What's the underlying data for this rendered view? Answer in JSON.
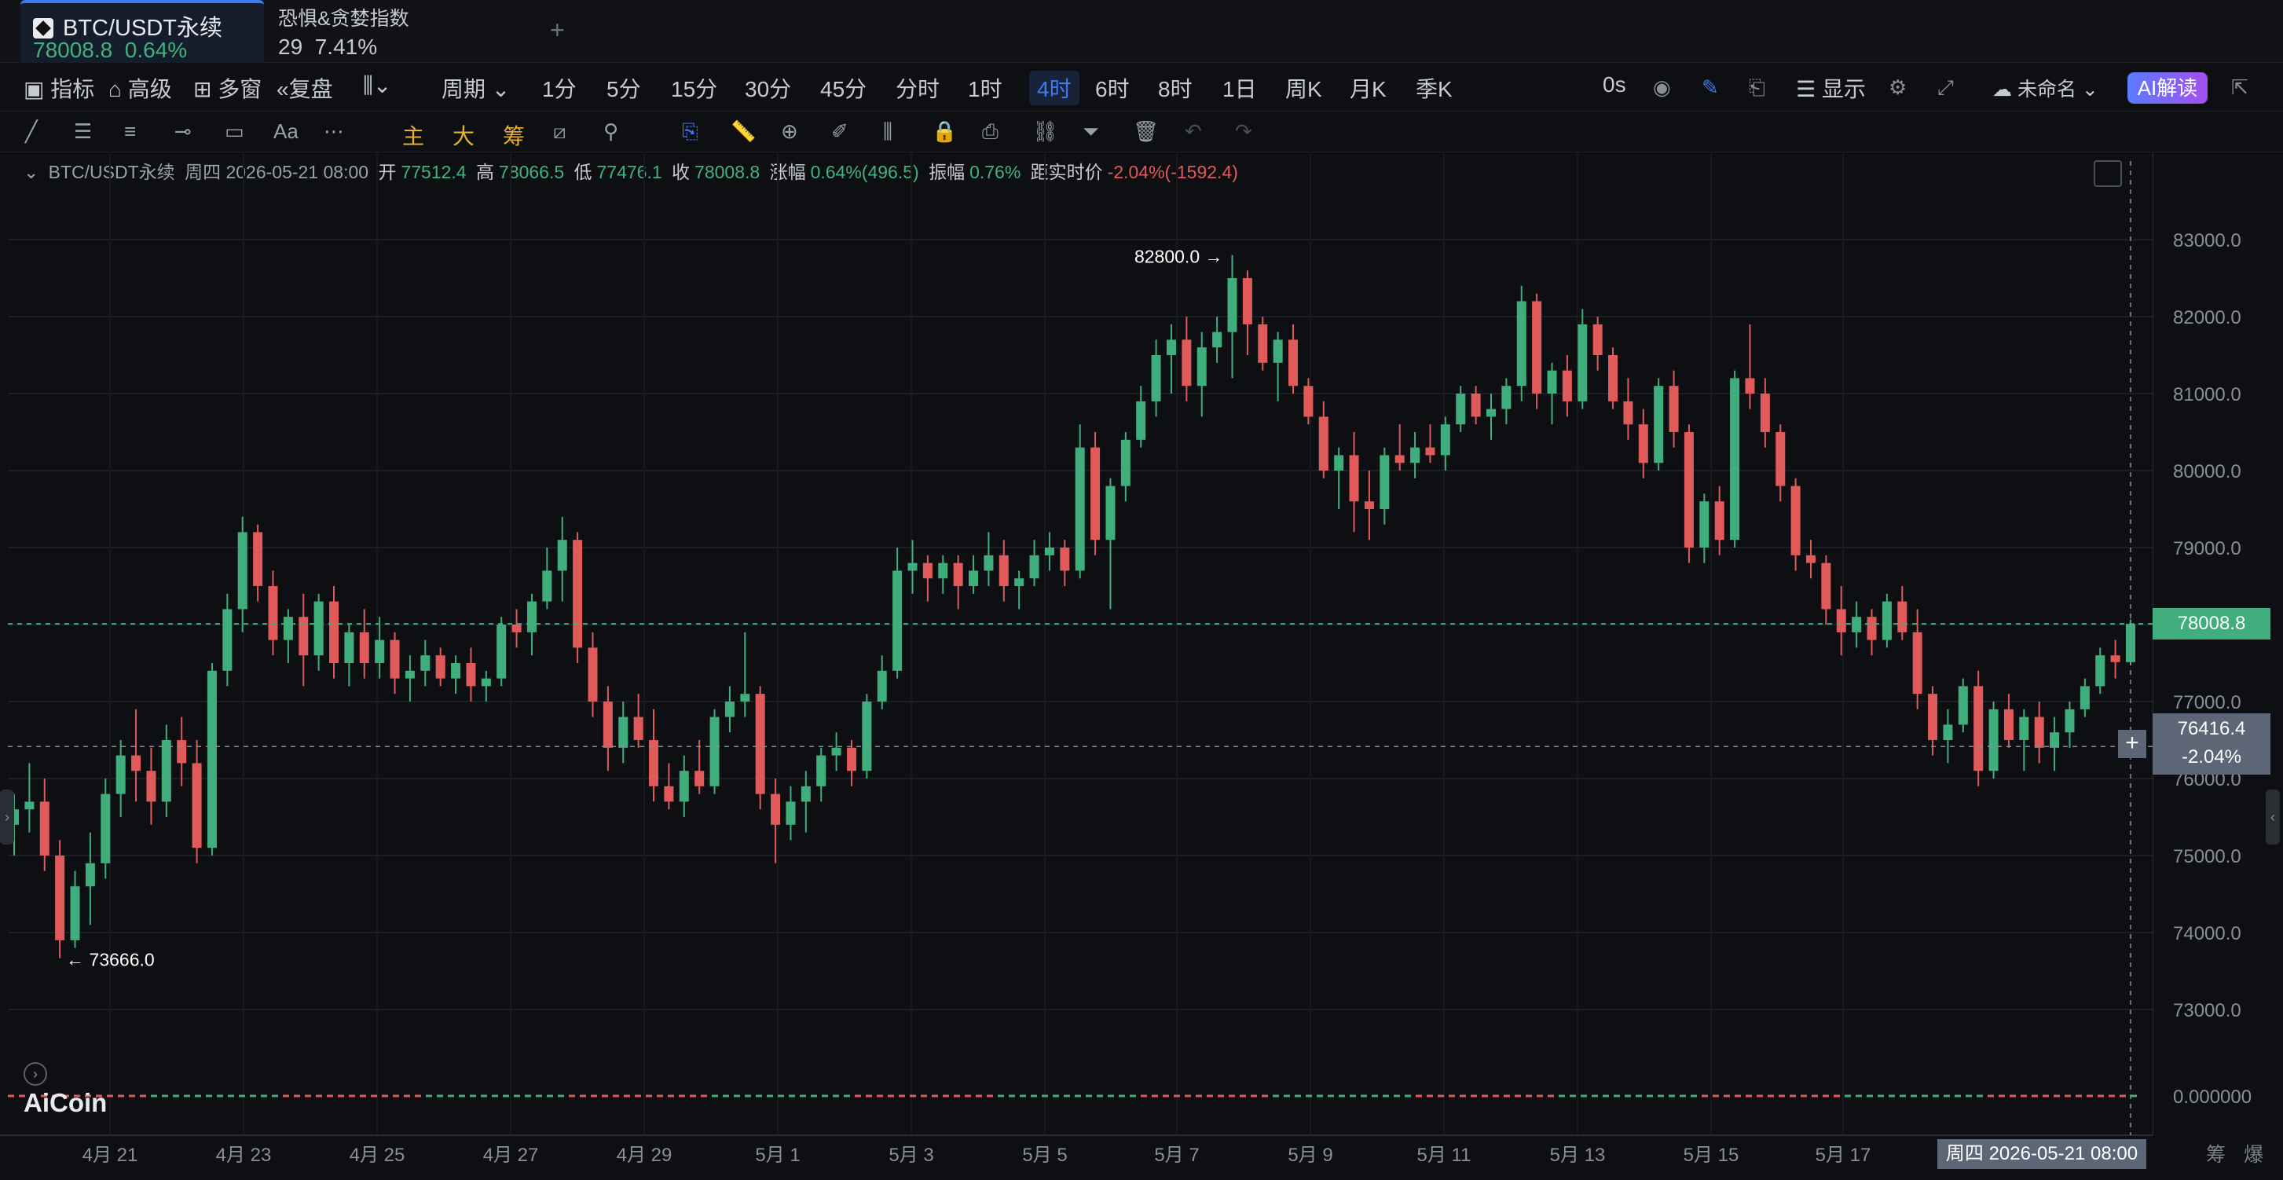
{
  "tabs": {
    "active": {
      "symbol": "BTC/USDT永续",
      "price": "78008.8",
      "change": "0.64%"
    },
    "second": {
      "name": "恐惧&贪婪指数",
      "value": "29",
      "change": "7.41%"
    }
  },
  "toolbar": {
    "indicator": "指标",
    "advanced": "高级",
    "multi_window": "多窗",
    "replay": "复盘",
    "period": "周期",
    "timeframes": [
      "1分",
      "5分",
      "15分",
      "30分",
      "45分",
      "分时",
      "1时",
      "4时",
      "6时",
      "8时",
      "1日",
      "周K",
      "月K",
      "季K"
    ],
    "selected_timeframe": "4时",
    "countdown": "0s",
    "display": "显示",
    "layout_name": "未命名",
    "ai_button": "AI解读"
  },
  "legend": {
    "symbol": "BTC/USDT永续",
    "datetime": "周四 2026-05-21 08:00",
    "open_label": "开",
    "open": "77512.4",
    "high_label": "高",
    "high": "78066.5",
    "low_label": "低",
    "low": "77476.1",
    "close_label": "收",
    "close": "78008.8",
    "change_label": "涨幅",
    "change": "0.64%(496.5)",
    "amp_label": "振幅",
    "amp": "0.76%",
    "dist_label": "距实时价",
    "dist": "-2.04%(-1592.4)"
  },
  "annotations": {
    "max_label": "82800.0",
    "min_label": "73666.0"
  },
  "price_tags": {
    "current": "78008.8",
    "cross_price": "76416.4",
    "cross_pct": "-2.04%"
  },
  "bottom_date": "周四 2026-05-21 08:00",
  "corner": {
    "chips": "筹",
    "liq": "爆"
  },
  "brand": "AiCoin",
  "colors": {
    "up": "#3fae7c",
    "down": "#e05a5a",
    "accent": "#3d7bf3"
  },
  "chart_data": {
    "type": "candlestick",
    "title": "",
    "y_ticks": [
      73000,
      74000,
      75000,
      76000,
      77000,
      78000,
      79000,
      80000,
      81000,
      82000,
      83000
    ],
    "y_tick_labels": [
      "73000.0",
      "74000.0",
      "75000.0",
      "76000.0",
      "77000.0",
      "78000.0",
      "79000.0",
      "80000.0",
      "81000.0",
      "82000.0",
      "83000.0"
    ],
    "ylim": [
      72300,
      83800
    ],
    "x_ticks": [
      "4月 21",
      "4月 23",
      "4月 25",
      "4月 27",
      "4月 29",
      "5月 1",
      "5月 3",
      "5月 5",
      "5月 7",
      "5月 9",
      "5月 11",
      "5月 13",
      "5月 15",
      "5月 17"
    ],
    "indicator_label": "0.000000",
    "candles": [
      [
        75400,
        75800,
        75000,
        75600
      ],
      [
        75600,
        76200,
        75300,
        75700
      ],
      [
        75700,
        76000,
        74800,
        75000
      ],
      [
        75000,
        75200,
        73666,
        73900
      ],
      [
        73900,
        74800,
        73800,
        74600
      ],
      [
        74600,
        75300,
        74100,
        74900
      ],
      [
        74900,
        76000,
        74700,
        75800
      ],
      [
        75800,
        76500,
        75500,
        76300
      ],
      [
        76300,
        76900,
        75700,
        76100
      ],
      [
        76100,
        76400,
        75400,
        75700
      ],
      [
        75700,
        76700,
        75500,
        76500
      ],
      [
        76500,
        76800,
        75900,
        76200
      ],
      [
        76200,
        76500,
        74900,
        75100
      ],
      [
        75100,
        77500,
        75000,
        77400
      ],
      [
        77400,
        78400,
        77200,
        78200
      ],
      [
        78200,
        79400,
        77900,
        79200
      ],
      [
        79200,
        79300,
        78300,
        78500
      ],
      [
        78500,
        78700,
        77600,
        77800
      ],
      [
        77800,
        78200,
        77500,
        78100
      ],
      [
        78100,
        78400,
        77200,
        77600
      ],
      [
        77600,
        78400,
        77400,
        78300
      ],
      [
        78300,
        78500,
        77300,
        77500
      ],
      [
        77500,
        78000,
        77200,
        77900
      ],
      [
        77900,
        78200,
        77300,
        77500
      ],
      [
        77500,
        78100,
        77300,
        77800
      ],
      [
        77800,
        77900,
        77100,
        77300
      ],
      [
        77300,
        77600,
        77000,
        77400
      ],
      [
        77400,
        77800,
        77200,
        77600
      ],
      [
        77600,
        77700,
        77200,
        77300
      ],
      [
        77300,
        77600,
        77100,
        77500
      ],
      [
        77500,
        77700,
        77000,
        77200
      ],
      [
        77200,
        77400,
        77000,
        77300
      ],
      [
        77300,
        78100,
        77200,
        78000
      ],
      [
        78000,
        78200,
        77700,
        77900
      ],
      [
        77900,
        78400,
        77600,
        78300
      ],
      [
        78300,
        79000,
        78200,
        78700
      ],
      [
        78700,
        79400,
        78300,
        79100
      ],
      [
        79100,
        79200,
        77500,
        77700
      ],
      [
        77700,
        77900,
        76800,
        77000
      ],
      [
        77000,
        77200,
        76100,
        76400
      ],
      [
        76400,
        77000,
        76200,
        76800
      ],
      [
        76800,
        77100,
        76400,
        76500
      ],
      [
        76500,
        76900,
        75700,
        75900
      ],
      [
        75900,
        76200,
        75600,
        75700
      ],
      [
        75700,
        76300,
        75500,
        76100
      ],
      [
        76100,
        76500,
        75800,
        75900
      ],
      [
        75900,
        76900,
        75800,
        76800
      ],
      [
        76800,
        77200,
        76600,
        77000
      ],
      [
        77000,
        77900,
        76800,
        77100
      ],
      [
        77100,
        77200,
        75600,
        75800
      ],
      [
        75800,
        76000,
        74900,
        75400
      ],
      [
        75400,
        75900,
        75200,
        75700
      ],
      [
        75700,
        76100,
        75300,
        75900
      ],
      [
        75900,
        76400,
        75700,
        76300
      ],
      [
        76300,
        76600,
        76100,
        76400
      ],
      [
        76400,
        76500,
        75900,
        76100
      ],
      [
        76100,
        77100,
        76000,
        77000
      ],
      [
        77000,
        77600,
        76900,
        77400
      ],
      [
        77400,
        79000,
        77300,
        78700
      ],
      [
        78700,
        79100,
        78400,
        78800
      ],
      [
        78800,
        78900,
        78300,
        78600
      ],
      [
        78600,
        78900,
        78400,
        78800
      ],
      [
        78800,
        78900,
        78200,
        78500
      ],
      [
        78500,
        78900,
        78400,
        78700
      ],
      [
        78700,
        79200,
        78500,
        78900
      ],
      [
        78900,
        79100,
        78300,
        78500
      ],
      [
        78500,
        78700,
        78200,
        78600
      ],
      [
        78600,
        79100,
        78500,
        78900
      ],
      [
        78900,
        79200,
        78700,
        79000
      ],
      [
        79000,
        79100,
        78500,
        78700
      ],
      [
        78700,
        80600,
        78600,
        80300
      ],
      [
        80300,
        80500,
        78900,
        79100
      ],
      [
        79100,
        79900,
        78200,
        79800
      ],
      [
        79800,
        80500,
        79600,
        80400
      ],
      [
        80400,
        81100,
        80300,
        80900
      ],
      [
        80900,
        81700,
        80700,
        81500
      ],
      [
        81500,
        81900,
        81000,
        81700
      ],
      [
        81700,
        82000,
        80900,
        81100
      ],
      [
        81100,
        81800,
        80700,
        81600
      ],
      [
        81600,
        82000,
        81400,
        81800
      ],
      [
        81800,
        82800,
        81200,
        82500
      ],
      [
        82500,
        82600,
        81500,
        81900
      ],
      [
        81900,
        82000,
        81300,
        81400
      ],
      [
        81400,
        81800,
        80900,
        81700
      ],
      [
        81700,
        81900,
        81000,
        81100
      ],
      [
        81100,
        81200,
        80600,
        80700
      ],
      [
        80700,
        80900,
        79900,
        80000
      ],
      [
        80000,
        80300,
        79500,
        80200
      ],
      [
        80200,
        80500,
        79200,
        79600
      ],
      [
        79600,
        80000,
        79100,
        79500
      ],
      [
        79500,
        80300,
        79300,
        80200
      ],
      [
        80200,
        80600,
        80000,
        80100
      ],
      [
        80100,
        80500,
        79900,
        80300
      ],
      [
        80300,
        80600,
        80100,
        80200
      ],
      [
        80200,
        80700,
        80000,
        80600
      ],
      [
        80600,
        81100,
        80500,
        81000
      ],
      [
        81000,
        81100,
        80600,
        80700
      ],
      [
        80700,
        81000,
        80400,
        80800
      ],
      [
        80800,
        81200,
        80600,
        81100
      ],
      [
        81100,
        82400,
        80900,
        82200
      ],
      [
        82200,
        82300,
        80800,
        81000
      ],
      [
        81000,
        81400,
        80600,
        81300
      ],
      [
        81300,
        81500,
        80700,
        80900
      ],
      [
        80900,
        82100,
        80800,
        81900
      ],
      [
        81900,
        82000,
        81300,
        81500
      ],
      [
        81500,
        81600,
        80800,
        80900
      ],
      [
        80900,
        81200,
        80400,
        80600
      ],
      [
        80600,
        80800,
        79900,
        80100
      ],
      [
        80100,
        81200,
        80000,
        81100
      ],
      [
        81100,
        81300,
        80300,
        80500
      ],
      [
        80500,
        80600,
        78800,
        79000
      ],
      [
        79000,
        79700,
        78800,
        79600
      ],
      [
        79600,
        79800,
        78900,
        79100
      ],
      [
        79100,
        81300,
        79000,
        81200
      ],
      [
        81200,
        81900,
        80800,
        81000
      ],
      [
        81000,
        81200,
        80300,
        80500
      ],
      [
        80500,
        80600,
        79600,
        79800
      ],
      [
        79800,
        79900,
        78700,
        78900
      ],
      [
        78900,
        79100,
        78600,
        78800
      ],
      [
        78800,
        78900,
        78000,
        78200
      ],
      [
        78200,
        78500,
        77600,
        77900
      ],
      [
        77900,
        78300,
        77700,
        78100
      ],
      [
        78100,
        78200,
        77600,
        77800
      ],
      [
        77800,
        78400,
        77700,
        78300
      ],
      [
        78300,
        78500,
        77800,
        77900
      ],
      [
        77900,
        78200,
        76900,
        77100
      ],
      [
        77100,
        77200,
        76300,
        76500
      ],
      [
        76500,
        76900,
        76200,
        76700
      ],
      [
        76700,
        77300,
        76600,
        77200
      ],
      [
        77200,
        77400,
        75900,
        76100
      ],
      [
        76100,
        77000,
        76000,
        76900
      ],
      [
        76900,
        77100,
        76400,
        76500
      ],
      [
        76500,
        76900,
        76100,
        76800
      ],
      [
        76800,
        77000,
        76200,
        76400
      ],
      [
        76400,
        76800,
        76100,
        76600
      ],
      [
        76600,
        77000,
        76400,
        76900
      ],
      [
        76900,
        77300,
        76800,
        77200
      ],
      [
        77200,
        77700,
        77100,
        77600
      ],
      [
        77600,
        77800,
        77300,
        77512
      ],
      [
        77512,
        78067,
        77476,
        78009
      ]
    ]
  }
}
